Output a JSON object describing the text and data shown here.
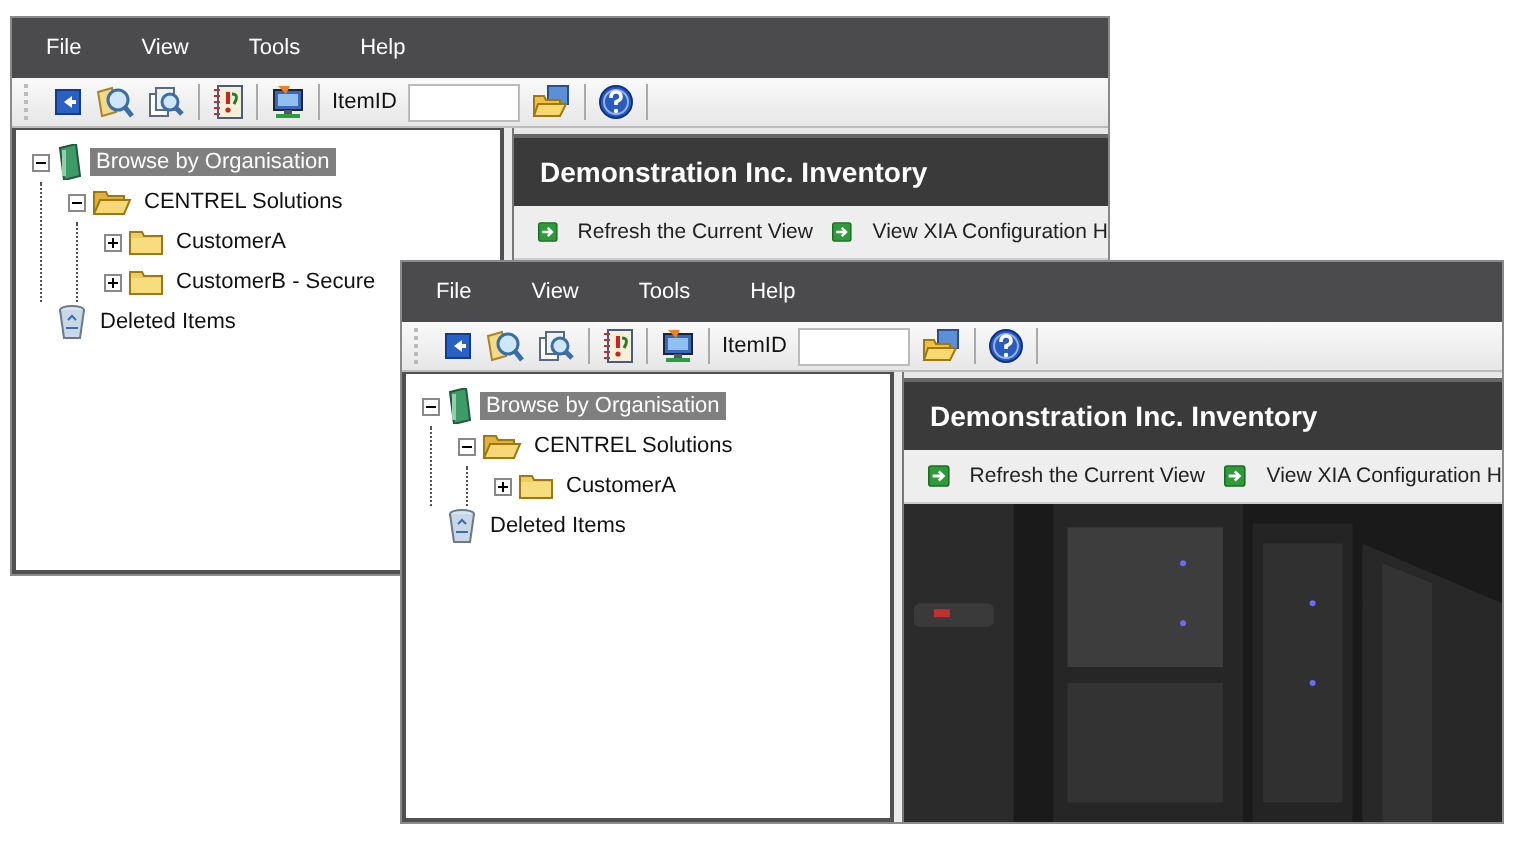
{
  "windows": [
    {
      "menu": [
        "File",
        "View",
        "Tools",
        "Help"
      ],
      "toolbar": {
        "item_label": "ItemID"
      },
      "tree": [
        {
          "label": "Browse by Organisation",
          "kind": "root",
          "expanded": true,
          "selected": true,
          "children": [
            {
              "label": "CENTREL Solutions",
              "kind": "folder",
              "expanded": true,
              "selected": false,
              "children": [
                {
                  "label": "CustomerA",
                  "kind": "folder",
                  "expanded": false,
                  "selected": false
                },
                {
                  "label": "CustomerB - Secure",
                  "kind": "folder",
                  "expanded": false,
                  "selected": false
                }
              ]
            }
          ]
        },
        {
          "label": "Deleted Items",
          "kind": "bin",
          "selected": false
        }
      ],
      "content": {
        "title": "Demonstration Inc. Inventory",
        "actions": [
          "Refresh the Current View",
          "View XIA Configuration H"
        ]
      }
    },
    {
      "menu": [
        "File",
        "View",
        "Tools",
        "Help"
      ],
      "toolbar": {
        "item_label": "ItemID"
      },
      "tree": [
        {
          "label": "Browse by Organisation",
          "kind": "root",
          "expanded": true,
          "selected": true,
          "children": [
            {
              "label": "CENTREL Solutions",
              "kind": "folder",
              "expanded": true,
              "selected": false,
              "children": [
                {
                  "label": "CustomerA",
                  "kind": "folder",
                  "expanded": false,
                  "selected": false
                }
              ]
            }
          ]
        },
        {
          "label": "Deleted Items",
          "kind": "bin",
          "selected": false
        }
      ],
      "content": {
        "title": "Demonstration Inc. Inventory",
        "actions": [
          "Refresh the Current View",
          "View XIA Configuration H"
        ]
      }
    }
  ]
}
